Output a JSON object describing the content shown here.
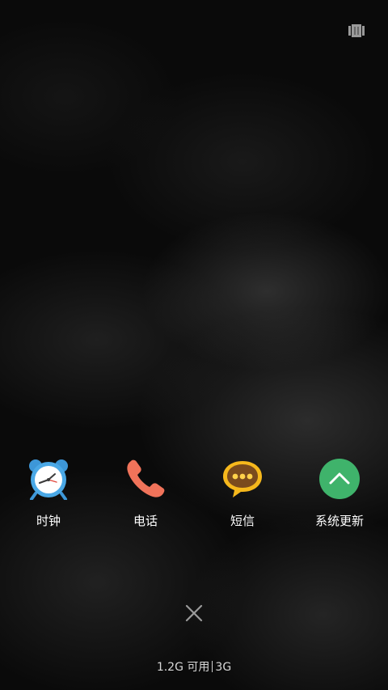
{
  "toolbar": {
    "clear_all_icon": "stacked-cards-icon"
  },
  "recent_apps": [
    {
      "label": "时钟",
      "icon": "alarm-clock-icon",
      "color": "#4aa8e6"
    },
    {
      "label": "电话",
      "icon": "phone-icon",
      "color": "#f0735a"
    },
    {
      "label": "短信",
      "icon": "message-bubble-icon",
      "color": "#f6b81c"
    },
    {
      "label": "系统更新",
      "icon": "chevron-up-icon",
      "color": "#3fb36b"
    }
  ],
  "close": {
    "icon": "close-icon"
  },
  "memory": {
    "available": "1.2G 可用",
    "total": "3G"
  }
}
